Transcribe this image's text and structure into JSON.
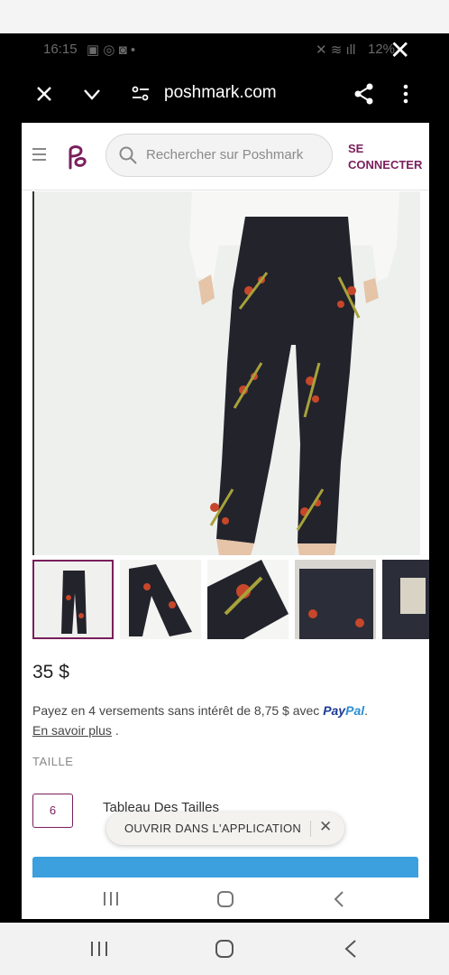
{
  "status": {
    "time": "16:15",
    "battery": "12%"
  },
  "browser": {
    "url": "poshmark.com"
  },
  "header": {
    "search_placeholder": "Rechercher sur Poshmark",
    "login_line1": "SE",
    "login_line2": "CONNECTER"
  },
  "product": {
    "price": "35 $",
    "installments": "Payez en 4 versements sans intérêt de 8,75 $ avec",
    "paypal_a": "Pay",
    "paypal_b": "Pal",
    "learn_more": "En savoir plus",
    "size_label": "TAILLE",
    "size_value": "6",
    "size_chart": "Tableau Des Tailles"
  },
  "toast": {
    "label": "OUVRIR DANS L'APPLICATION"
  },
  "colors": {
    "brand": "#7a1f5c",
    "button": "#3ba0dd"
  }
}
